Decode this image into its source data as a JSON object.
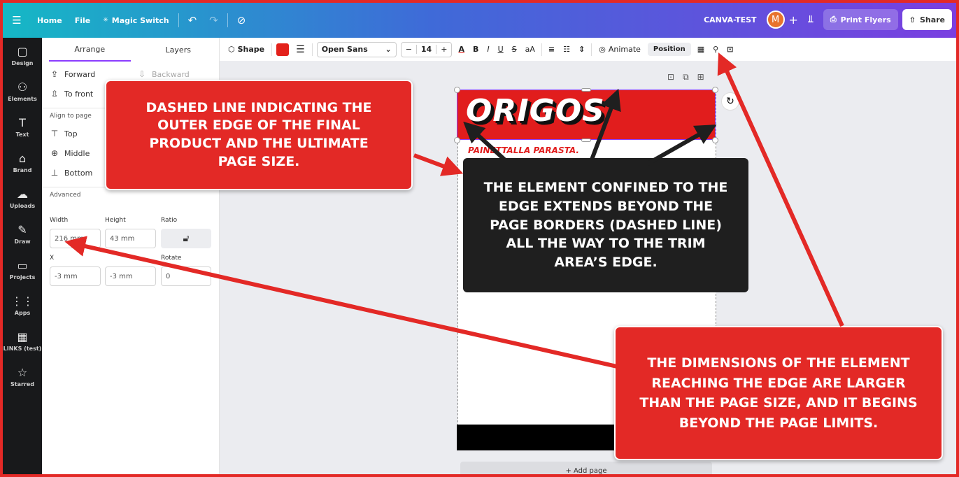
{
  "topbar": {
    "menu_icon": "hamburger-icon",
    "home": "Home",
    "file": "File",
    "magic_switch": "Magic Switch",
    "project_name": "CANVA-TEST",
    "avatar_initial": "M",
    "add": "+",
    "print_label": "Print Flyers",
    "share_label": "Share"
  },
  "rail": {
    "items": [
      {
        "label": "Design",
        "icon": "▢"
      },
      {
        "label": "Elements",
        "icon": "⚇"
      },
      {
        "label": "Text",
        "icon": "T"
      },
      {
        "label": "Brand",
        "icon": "⌂"
      },
      {
        "label": "Uploads",
        "icon": "☁"
      },
      {
        "label": "Draw",
        "icon": "✎"
      },
      {
        "label": "Projects",
        "icon": "▭"
      },
      {
        "label": "Apps",
        "icon": "⋮⋮"
      },
      {
        "label": "LINKS (test)",
        "icon": "▦"
      },
      {
        "label": "Starred",
        "icon": "☆"
      }
    ]
  },
  "panel": {
    "tab_arrange": "Arrange",
    "tab_layers": "Layers",
    "forward": "Forward",
    "backward": "Backward",
    "to_front": "To front",
    "align_to_page": "Align to page",
    "top": "Top",
    "middle": "Middle",
    "bottom": "Bottom",
    "advanced": "Advanced",
    "width_label": "Width",
    "height_label": "Height",
    "ratio_label": "Ratio",
    "width_value": "216 mm",
    "height_value": "43 mm",
    "x_label": "X",
    "rotate_label": "Rotate",
    "x_value": "-3 mm",
    "y_value": "-3 mm",
    "rotate_value": "0"
  },
  "toolbar": {
    "shape": "Shape",
    "color": "#e3211b",
    "font": "Open Sans",
    "minus": "−",
    "font_size": "14",
    "plus": "+",
    "case": "aA",
    "animate": "Animate",
    "position": "Position"
  },
  "canvas": {
    "logo_text": "ORIGOS",
    "tagline": "PAINETTALLA PARASTA.",
    "add_page": "+ Add page"
  },
  "callouts": {
    "dashed_line": "DASHED LINE INDICATING THE OUTER EDGE OF THE FINAL PRODUCT AND THE ULTIMATE PAGE SIZE.",
    "element_confined": "THE ELEMENT CONFINED TO THE EDGE EXTENDS BEYOND THE PAGE BORDERS (DASHED LINE) ALL THE WAY TO THE TRIM AREA’S EDGE.",
    "dimensions": "THE DIMENSIONS OF THE ELEMENT REACHING THE EDGE ARE LARGER THAN THE PAGE SIZE, AND IT BEGINS BEYOND THE PAGE LIMITS."
  },
  "colors": {
    "frame": "#e32926",
    "accent": "#8b3dff",
    "callout_dark": "#1f1f1f"
  }
}
